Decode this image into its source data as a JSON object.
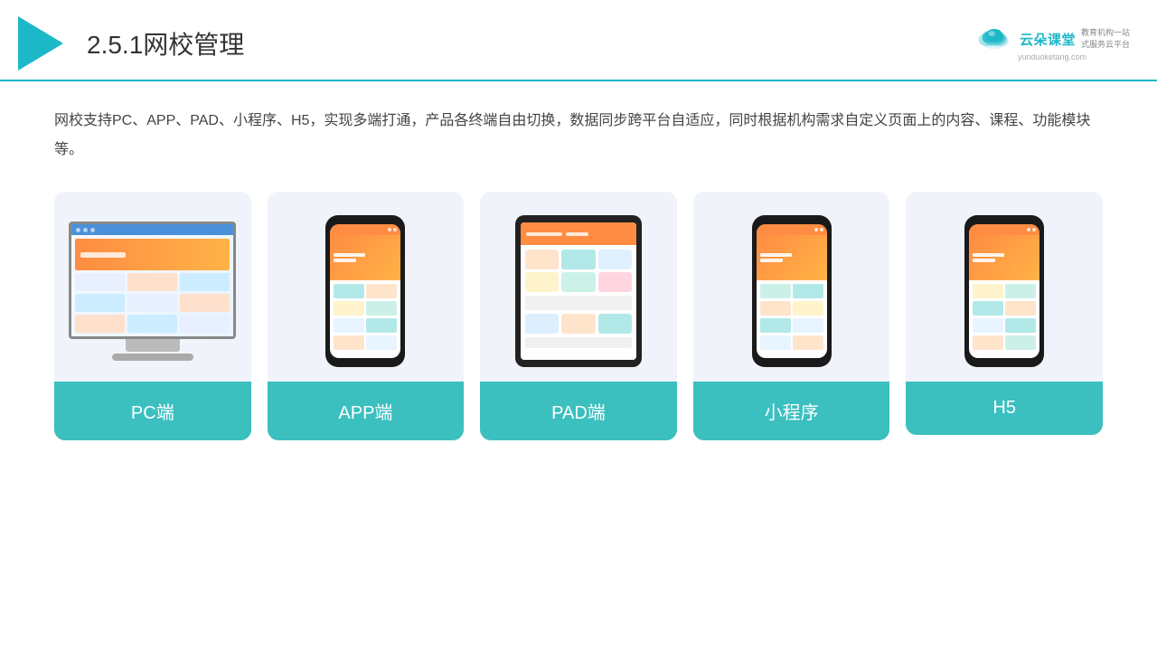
{
  "header": {
    "title_prefix": "2.5.1",
    "title_main": "网校管理",
    "brand_name": "云朵课堂",
    "brand_desc_line1": "教育机构一站",
    "brand_desc_line2": "式服务云平台",
    "brand_url": "yunduoketang.com"
  },
  "description": {
    "text": "网校支持PC、APP、PAD、小程序、H5，实现多端打通，产品各终端自由切换，数据同步跨平台自适应，同时根据机构需求自定义页面上的内容、课程、功能模块等。"
  },
  "cards": [
    {
      "id": "pc",
      "label": "PC端"
    },
    {
      "id": "app",
      "label": "APP端"
    },
    {
      "id": "pad",
      "label": "PAD端"
    },
    {
      "id": "miniprogram",
      "label": "小程序"
    },
    {
      "id": "h5",
      "label": "H5"
    }
  ],
  "colors": {
    "accent": "#1db8c8",
    "card_bg": "#eef2f8",
    "card_label_bg": "#3bbfbf",
    "header_border": "#1db8c8"
  }
}
